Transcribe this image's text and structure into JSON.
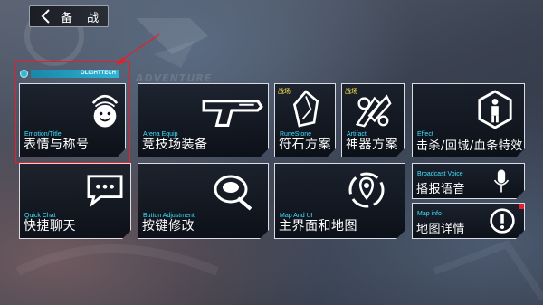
{
  "header": {
    "back_label": "备 战"
  },
  "brand_text": "OLIGHTTECH",
  "background_text": "ADVENTURE",
  "tiles": [
    {
      "en": "Emotion/Title",
      "cn": "表情与称号",
      "icon": "smiley-bubble-icon"
    },
    {
      "en": "Arena Equip",
      "cn": "竞技场装备",
      "icon": "pistol-icon"
    },
    {
      "tag": "战场",
      "en": "RuneStone",
      "cn": "符石方案",
      "icon": "rune-crystal-icon"
    },
    {
      "tag": "战场",
      "en": "Artifact",
      "cn": "神器方案",
      "icon": "artifact-gears-icon"
    },
    {
      "en": "Effect",
      "cn": "击杀/回城/血条特效",
      "icon": "figure-hexagon-icon"
    },
    {
      "en": "Quick Chat",
      "cn": "快捷聊天",
      "icon": "chat-bubble-icon"
    },
    {
      "en": "Button Adjustment",
      "cn": "按键修改",
      "icon": "button-edit-icon"
    },
    {
      "en": "Map And UI",
      "cn": "主界面和地图",
      "icon": "map-pin-icon"
    },
    {
      "en": "Broadcast Voice",
      "cn": "播报语音",
      "icon": "microphone-icon"
    },
    {
      "en": "Map info",
      "cn": "地图详情",
      "icon": "exclamation-icon"
    }
  ],
  "colors": {
    "accent_cyan": "#3fe0ff",
    "tag_yellow": "#ffe94a",
    "highlight_red": "#e4202a"
  }
}
